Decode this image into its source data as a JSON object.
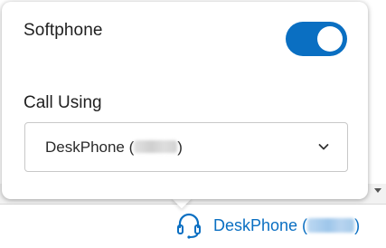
{
  "softphone": {
    "label": "Softphone",
    "toggle_on": true
  },
  "call_using": {
    "label": "Call Using",
    "selected_prefix": "DeskPhone (",
    "selected_suffix": ")"
  },
  "device_indicator": {
    "prefix": "DeskPhone (",
    "suffix": ")"
  },
  "colors": {
    "accent": "#0a6fc2",
    "text": "#1f1f1f"
  }
}
